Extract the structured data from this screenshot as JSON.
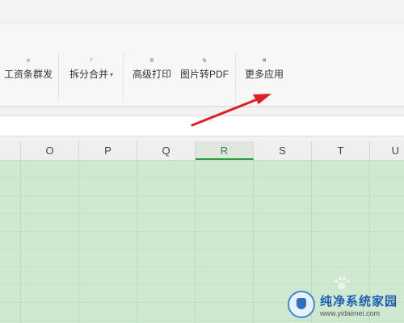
{
  "ribbon": {
    "tools": [
      {
        "label": "工资条群发",
        "icon": "payslip-send-icon"
      },
      {
        "label": "拆分合并",
        "icon": "split-merge-icon",
        "has_dropdown": true
      },
      {
        "label": "高级打印",
        "icon": "printer-icon"
      },
      {
        "label": "图片转PDF",
        "icon": "image-to-pdf-icon"
      },
      {
        "label": "更多应用",
        "icon": "more-apps-icon"
      }
    ]
  },
  "sheet": {
    "columns": [
      "O",
      "P",
      "Q",
      "R",
      "S",
      "T",
      "U"
    ],
    "active_column": "R"
  },
  "colors": {
    "grid_fill": "#cfe9d1",
    "active_header": "#2f9a3f",
    "annotation_arrow": "#e02020"
  },
  "watermark": {
    "title": "纯净系统家园",
    "url": "www.yidaimei.com"
  }
}
